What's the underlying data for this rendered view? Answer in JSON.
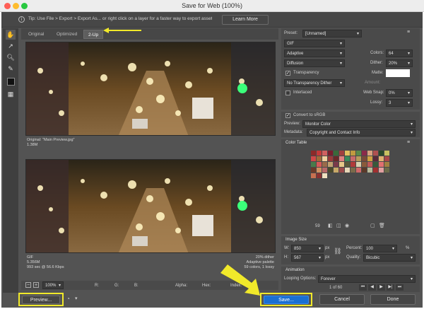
{
  "window": {
    "title": "Save for Web (100%)"
  },
  "tip": {
    "text": "Tip: Use File > Export > Export As... or right click on a layer for a faster way to export assets",
    "learn_more": "Learn More"
  },
  "view_tabs": [
    "Original",
    "Optimized",
    "2-Up"
  ],
  "preview_top": {
    "line1": "Original: \"Main Preview.jpg\"",
    "line2": "1.38M"
  },
  "preview_bottom": {
    "left1": "GIF",
    "left2": "5.356M",
    "left3": "993 sec @ 56.6 Kbps",
    "right1": "20% dither",
    "right2": "Adaptive palette",
    "right3": "59 colors, 1 lossy"
  },
  "status_bar": {
    "zoom": "100%",
    "r": "R:",
    "g": "G:",
    "b": "B:",
    "alpha": "Alpha:",
    "hex": "Hex:",
    "index": "Index:"
  },
  "settings": {
    "preset_label": "Preset:",
    "preset_value": "[Unnamed]",
    "format": "GIF",
    "reduction": "Adaptive",
    "colors_label": "Colors:",
    "colors_value": "64",
    "dither_algo": "Diffusion",
    "dither_label": "Dither:",
    "dither_value": "20%",
    "transparency_label": "Transparency",
    "transparency_checked": true,
    "matte_label": "Matte:",
    "trans_dither": "No Transparency Dither",
    "amount_label": "Amount:",
    "interlaced_label": "Interlaced",
    "interlaced_checked": false,
    "websnap_label": "Web Snap:",
    "websnap_value": "0%",
    "lossy_label": "Lossy:",
    "lossy_value": "3",
    "srgb_label": "Convert to sRGB",
    "srgb_checked": true,
    "preview_label": "Preview:",
    "preview_value": "Monitor Color",
    "metadata_label": "Metadata:",
    "metadata_value": "Copyright and Contact Info"
  },
  "color_table": {
    "title": "Color Table",
    "count": "59",
    "swatches": [
      "#8c2a2a",
      "#c43a3a",
      "#d06060",
      "#7a1d2e",
      "#3a6a3a",
      "#a04040",
      "#e0c060",
      "#c09a40",
      "#5a8a4a",
      "#8a2a4a",
      "#d8a080",
      "#b05050",
      "#2a4a2a",
      "#c8c060",
      "#d04848",
      "#a06a3a",
      "#f0d0a0",
      "#9a3a3a",
      "#6a2a2a",
      "#e08080",
      "#3a8a5a",
      "#c86a6a",
      "#b89a5a",
      "#7a4a3a",
      "#d0a040",
      "#5a2a3a",
      "#e0b070",
      "#a84848",
      "#4a7a4a",
      "#d85858",
      "#9a6a4a",
      "#c0a070",
      "#7a3a4a",
      "#e8c888",
      "#5a5a3a",
      "#b03a3a",
      "#d8d0b0",
      "#8a5a3a",
      "#c05858",
      "#3a5a3a",
      "#e07070",
      "#a08040",
      "#6a3a2a",
      "#d09060",
      "#b86868",
      "#4a4a2a",
      "#c8a868",
      "#9a4a4a",
      "#e8d8b8",
      "#7a6a4a",
      "#d06868",
      "#5a3a2a",
      "#b8b898",
      "#a03030",
      "#e0a0a0",
      "#6a6a4a",
      "#c87050",
      "#8a3030",
      "#f0e0c0"
    ]
  },
  "image_size": {
    "title": "Image Size",
    "w_label": "W:",
    "w_value": "850",
    "h_label": "H:",
    "h_value": "567",
    "unit": "px",
    "percent_label": "Percent:",
    "percent_value": "100",
    "percent_unit": "%",
    "quality_label": "Quality:",
    "quality_value": "Bicubic"
  },
  "animation": {
    "title": "Animation",
    "looping_label": "Looping Options:",
    "looping_value": "Forever",
    "frame": "1 of 60"
  },
  "buttons": {
    "preview": "Preview...",
    "save": "Save...",
    "cancel": "Cancel",
    "done": "Done"
  },
  "colors": {
    "highlight": "#f1e92a",
    "panel": "#535353"
  }
}
